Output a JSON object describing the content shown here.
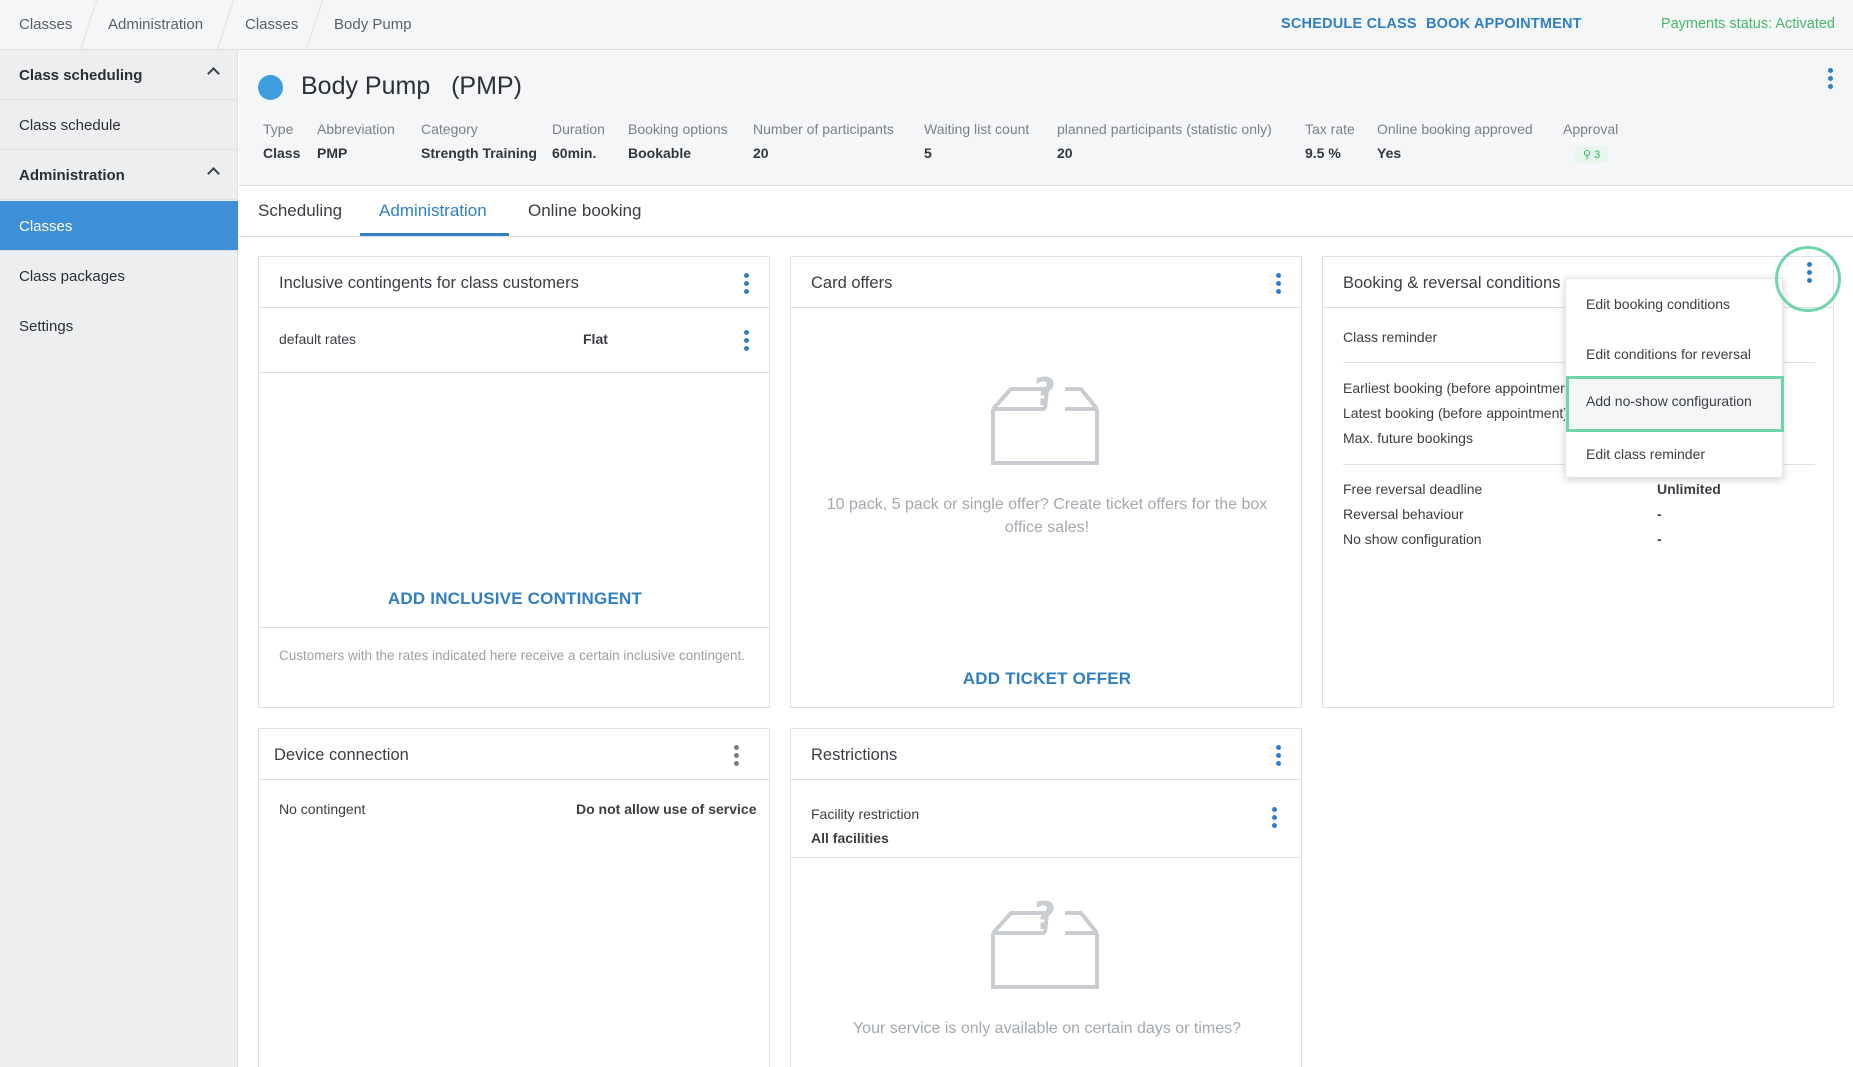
{
  "breadcrumb": [
    "Classes",
    "Administration",
    "Classes",
    "Body Pump"
  ],
  "top_actions": {
    "schedule": "SCHEDULE CLASS",
    "book": "BOOK APPOINTMENT"
  },
  "payments_status": "Payments status: Activated",
  "sidebar": {
    "items": [
      {
        "label": "Class scheduling"
      },
      {
        "label": "Class schedule"
      },
      {
        "label": "Administration"
      },
      {
        "label": "Classes"
      },
      {
        "label": "Class packages"
      },
      {
        "label": "Settings"
      }
    ]
  },
  "page": {
    "title": "Body Pump",
    "abbr": "(PMP)",
    "attributes": [
      {
        "label": "Type",
        "value": "Class"
      },
      {
        "label": "Abbreviation",
        "value": "PMP"
      },
      {
        "label": "Category",
        "value": "Strength Training"
      },
      {
        "label": "Duration",
        "value": "60min."
      },
      {
        "label": "Booking options",
        "value": "Bookable"
      },
      {
        "label": "Number of participants",
        "value": "20"
      },
      {
        "label": "Waiting list count",
        "value": "5"
      },
      {
        "label": "planned participants (statistic only)",
        "value": "20"
      },
      {
        "label": "Tax rate",
        "value": "9.5 %"
      },
      {
        "label": "Online booking approved",
        "value": "Yes"
      },
      {
        "label": "Approval",
        "value": "3"
      }
    ]
  },
  "tabs": [
    {
      "label": "Scheduling"
    },
    {
      "label": "Administration"
    },
    {
      "label": "Online booking"
    }
  ],
  "cards": {
    "contingents": {
      "title": "Inclusive contingents for class customers",
      "row_label": "default rates",
      "row_value": "Flat",
      "action": "ADD INCLUSIVE CONTINGENT",
      "note": "Customers with the rates indicated here receive a certain inclusive contingent."
    },
    "card_offers": {
      "title": "Card offers",
      "empty": "10 pack, 5 pack or single offer? Create ticket offers for the box office sales!",
      "action": "ADD TICKET OFFER"
    },
    "booking": {
      "title": "Booking & reversal conditions",
      "class_reminder": "Class reminder",
      "earliest": "Earliest booking (before appointment)",
      "latest": "Latest booking (before appointment)",
      "max_future": "Max. future bookings",
      "free_reversal": "Free reversal deadline",
      "free_reversal_value": "Unlimited",
      "reversal_behaviour": "Reversal behaviour",
      "reversal_behaviour_value": "-",
      "no_show": "No show configuration",
      "no_show_value": "-"
    },
    "device": {
      "title": "Device connection",
      "row_label": "No contingent",
      "row_value": "Do not allow use of service"
    },
    "restrictions": {
      "title": "Restrictions",
      "facility_label": "Facility restriction",
      "facility_value": "All facilities",
      "empty": "Your service is only available on certain days or times?"
    }
  },
  "context_menu": {
    "items": [
      {
        "label": "Edit booking conditions"
      },
      {
        "label": "Edit conditions for reversal"
      },
      {
        "label": "Add no-show configuration"
      },
      {
        "label": "Edit class reminder"
      }
    ]
  },
  "colors": {
    "accent": "#2f7fc4",
    "sidebar_active": "#3d8fd8",
    "success": "#47b86a",
    "highlight": "#6ed6a8"
  }
}
